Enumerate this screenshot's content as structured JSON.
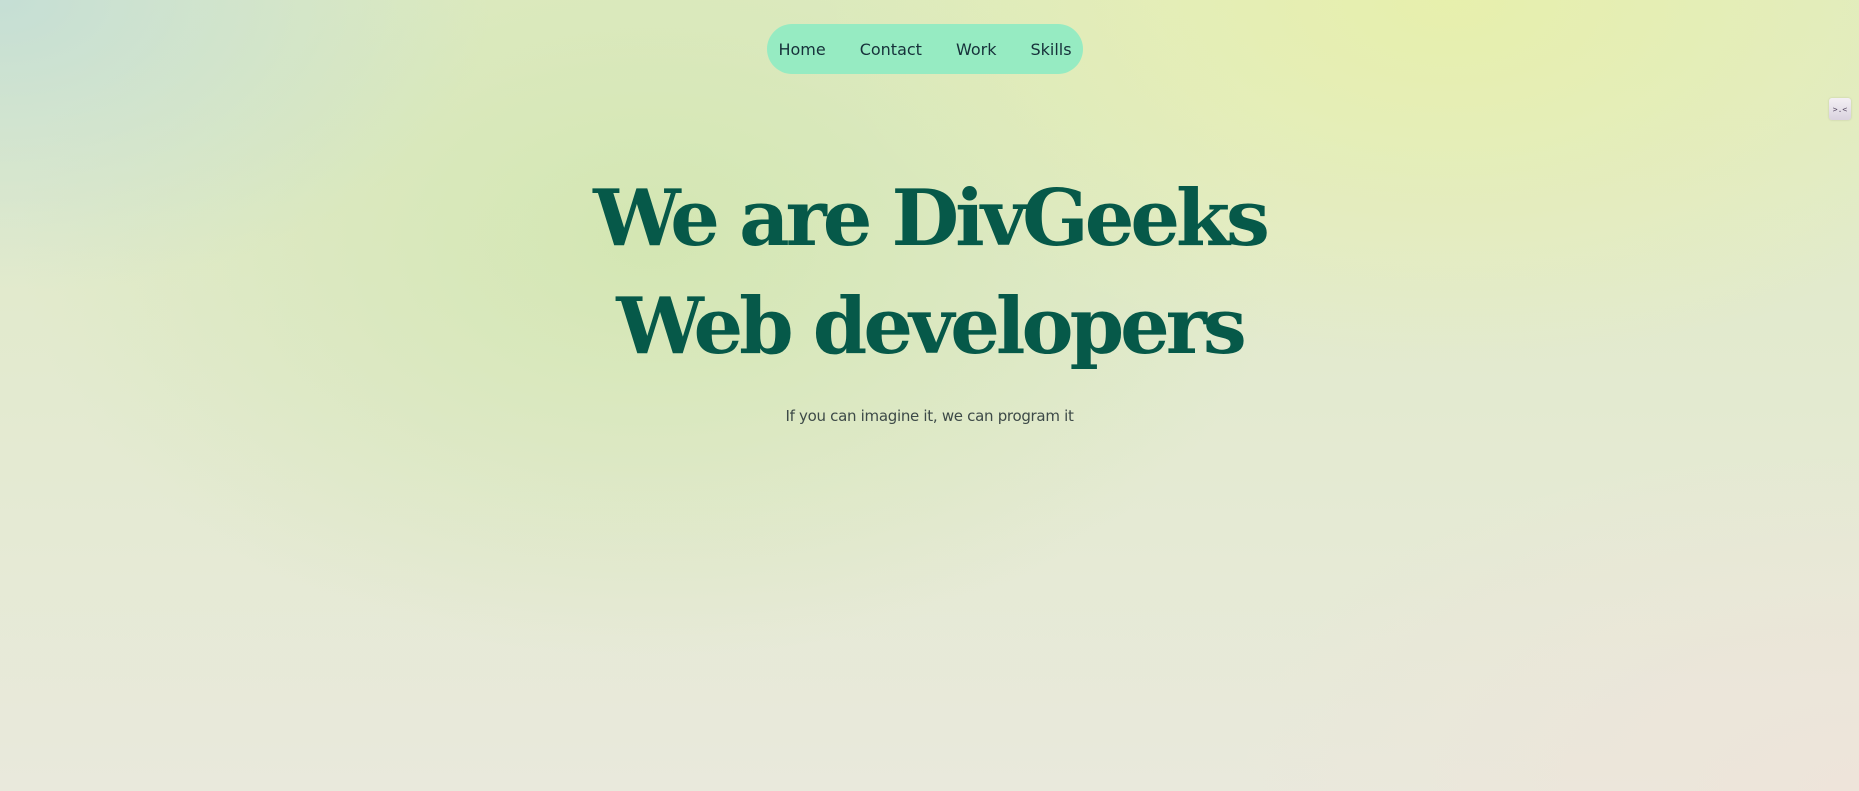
{
  "nav": {
    "items": [
      {
        "label": "Home"
      },
      {
        "label": "Contact"
      },
      {
        "label": "Work"
      },
      {
        "label": "Skills"
      }
    ]
  },
  "hero": {
    "line1": "We are DivGeeks",
    "line2": "Web developers",
    "tagline": "If you can imagine it, we can program it"
  },
  "widget": {
    "label": ">.<"
  },
  "colors": {
    "heading": "#065949",
    "nav_background": "#96ebc2",
    "nav_text": "#16313a",
    "tagline": "#3d4a48"
  }
}
